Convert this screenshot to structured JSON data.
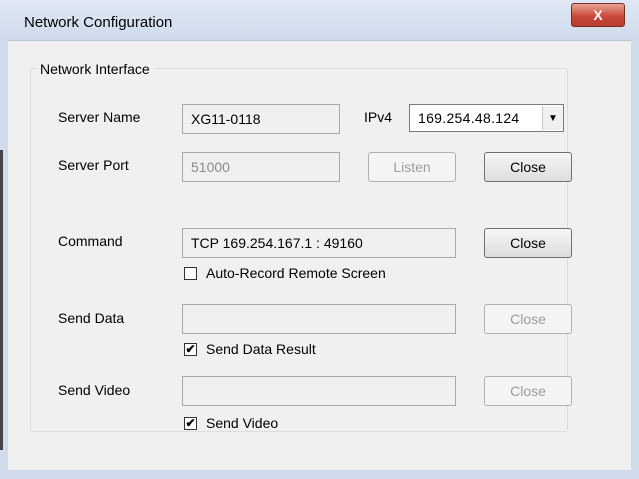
{
  "window": {
    "title": "Network Configuration",
    "close_glyph": "X"
  },
  "group": {
    "legend": "Network Interface"
  },
  "server": {
    "name_label": "Server Name",
    "name_value": "XG11-0118",
    "ipv4_label": "IPv4",
    "ipv4_value": "169.254.48.124",
    "port_label": "Server Port",
    "port_value": "51000",
    "listen_label": "Listen",
    "close_label": "Close"
  },
  "command": {
    "label": "Command",
    "value": "TCP 169.254.167.1 : 49160",
    "close_label": "Close",
    "auto_record_label": "Auto-Record Remote Screen",
    "auto_record_checked": false
  },
  "send_data": {
    "label": "Send Data",
    "value": "",
    "close_label": "Close",
    "result_label": "Send Data Result",
    "result_checked": true
  },
  "send_video": {
    "label": "Send Video",
    "value": "",
    "close_label": "Close",
    "check_label": "Send Video",
    "check_checked": true
  },
  "glyphs": {
    "check": "✔",
    "dropdown": "▼"
  }
}
